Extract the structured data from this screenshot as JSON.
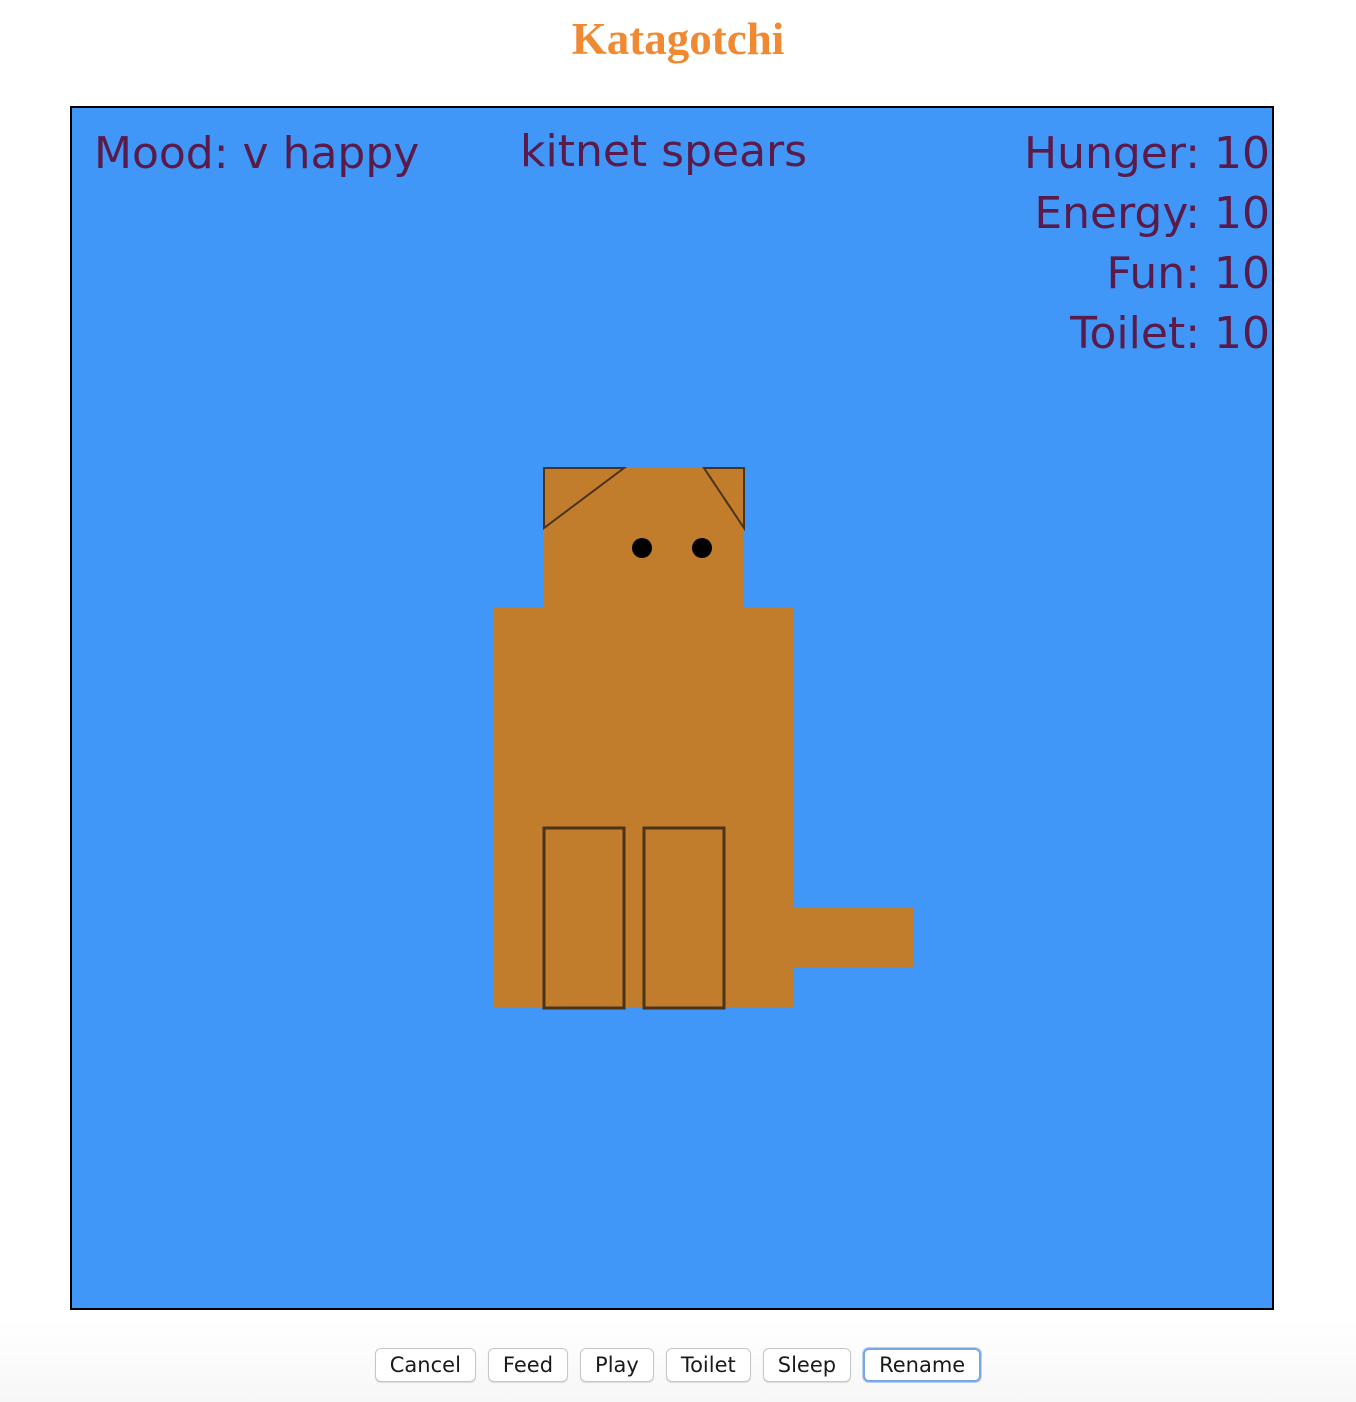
{
  "app": {
    "title": "Katagotchi",
    "title_color": "#ef8a33"
  },
  "game": {
    "background_color": "#4097f7",
    "text_color": "#5a1a4a",
    "mood_text": "Mood: v happy",
    "pet_name": "kitnet spears",
    "stats": [
      {
        "label": "Hunger: 10"
      },
      {
        "label": "Energy: 10"
      },
      {
        "label": "Fun: 10"
      },
      {
        "label": "Toilet: 10"
      }
    ],
    "cat_color": "#c17d2b",
    "outline_color": "#4a3318"
  },
  "controls": {
    "buttons": [
      {
        "label": "Cancel"
      },
      {
        "label": "Feed"
      },
      {
        "label": "Play"
      },
      {
        "label": "Toilet"
      },
      {
        "label": "Sleep"
      },
      {
        "label": "Rename",
        "focused": true
      }
    ]
  }
}
